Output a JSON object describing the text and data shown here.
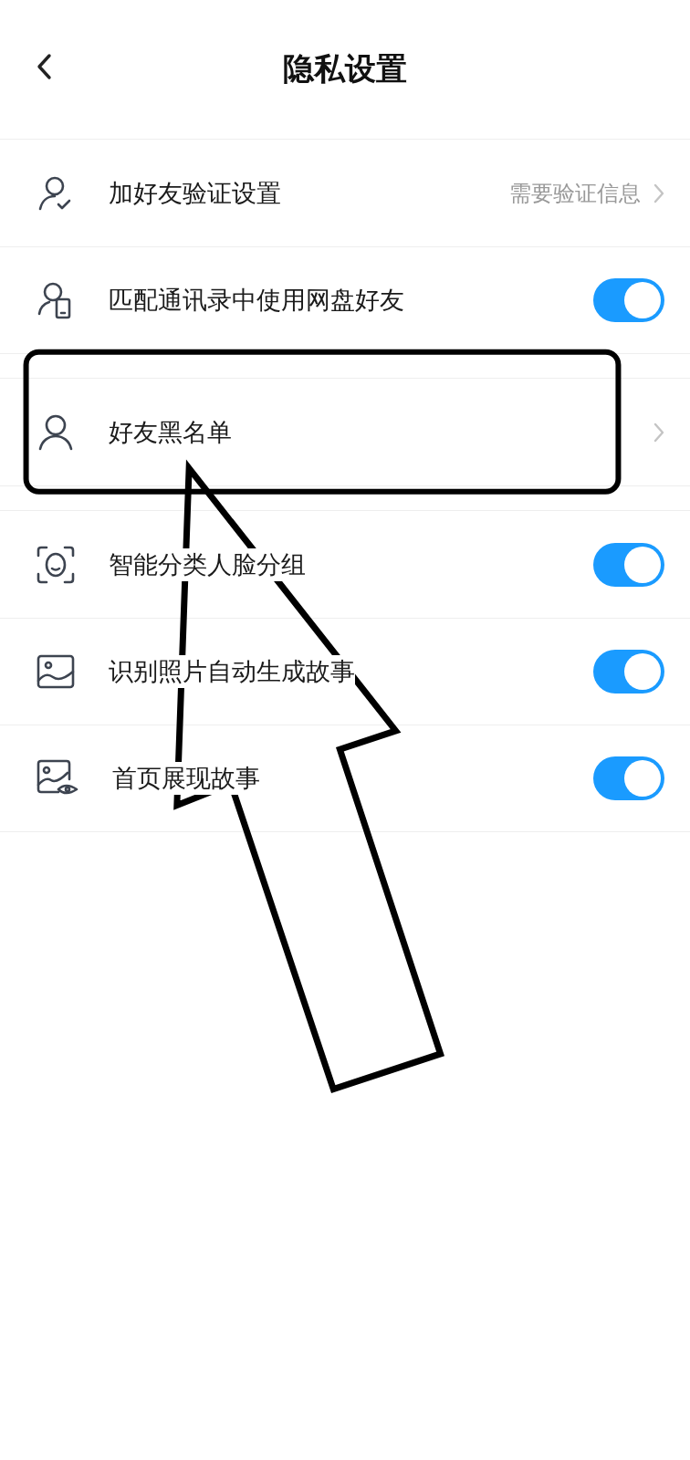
{
  "header": {
    "title": "隐私设置"
  },
  "groups": [
    {
      "items": [
        {
          "kind": "link",
          "label": "加好友验证设置",
          "value": "需要验证信息"
        },
        {
          "kind": "toggle",
          "label": "匹配通讯录中使用网盘好友",
          "on": true
        }
      ]
    },
    {
      "items": [
        {
          "kind": "link",
          "label": "好友黑名单"
        }
      ]
    },
    {
      "items": [
        {
          "kind": "toggle",
          "label": "智能分类人脸分组",
          "on": true
        },
        {
          "kind": "toggle",
          "label": "识别照片自动生成故事",
          "on": true
        },
        {
          "kind": "toggle",
          "label": "首页展现故事",
          "on": true
        }
      ]
    }
  ]
}
